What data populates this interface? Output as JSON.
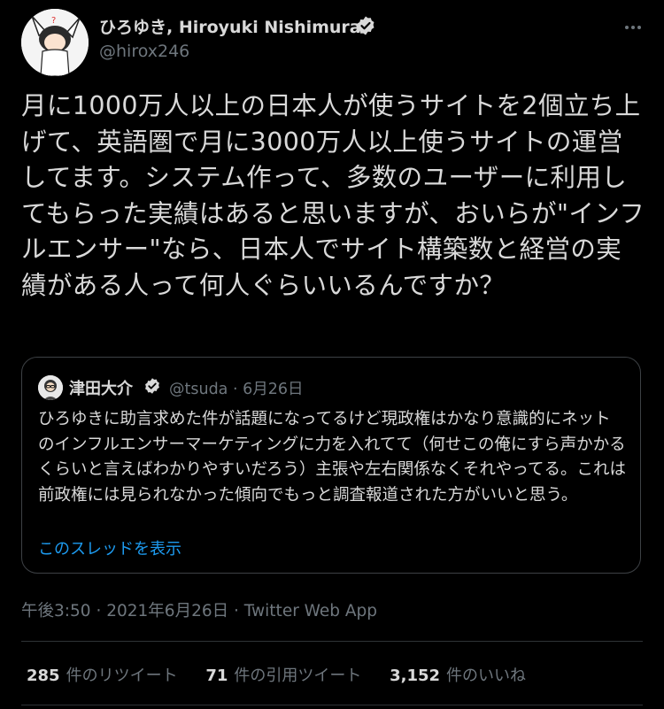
{
  "author": {
    "name": "ひろゆき, Hiroyuki Nishimura",
    "handle": "@hirox246"
  },
  "tweet": {
    "text": "月に1000万人以上の日本人が使うサイトを2個立ち上げて、英語圏で月に3000万人以上使うサイトの運営してます。システム作って、多数のユーザーに利用してもらった実績はあると思いますが、おいらが\"インフルエンサー\"なら、日本人でサイト構築数と経営の実績がある人って何人ぐらいいるんですか？"
  },
  "quote": {
    "name": "津田大介",
    "handle": "@tsuda",
    "separator": "·",
    "date": "6月26日",
    "text": "ひろゆきに助言求めた件が話題になってるけど現政権はかなり意識的にネットのインフルエンサーマーケティングに力を入れてて（何せこの俺にすら声かかるくらいと言えばわかりやすいだろう）主張や左右関係なくそれやってる。これは前政権には見られなかった傾向でもっと調査報道された方がいいと思う。",
    "show_thread": "このスレッドを表示"
  },
  "meta": {
    "time": "午後3:50",
    "separator": "·",
    "date": "2021年6月26日",
    "source": "Twitter Web App"
  },
  "stats": {
    "retweets_count": "285",
    "retweets_label": "件のリツイート",
    "quotes_count": "71",
    "quotes_label": "件の引用ツイート",
    "likes_count": "3,152",
    "likes_label": "件のいいね"
  },
  "colors": {
    "background": "#000000",
    "text": "#d9d9d9",
    "secondary": "#6e767d",
    "link": "#1d9bf0",
    "border": "#2f3336"
  },
  "icons": [
    "more-icon",
    "verified-badge-icon"
  ]
}
